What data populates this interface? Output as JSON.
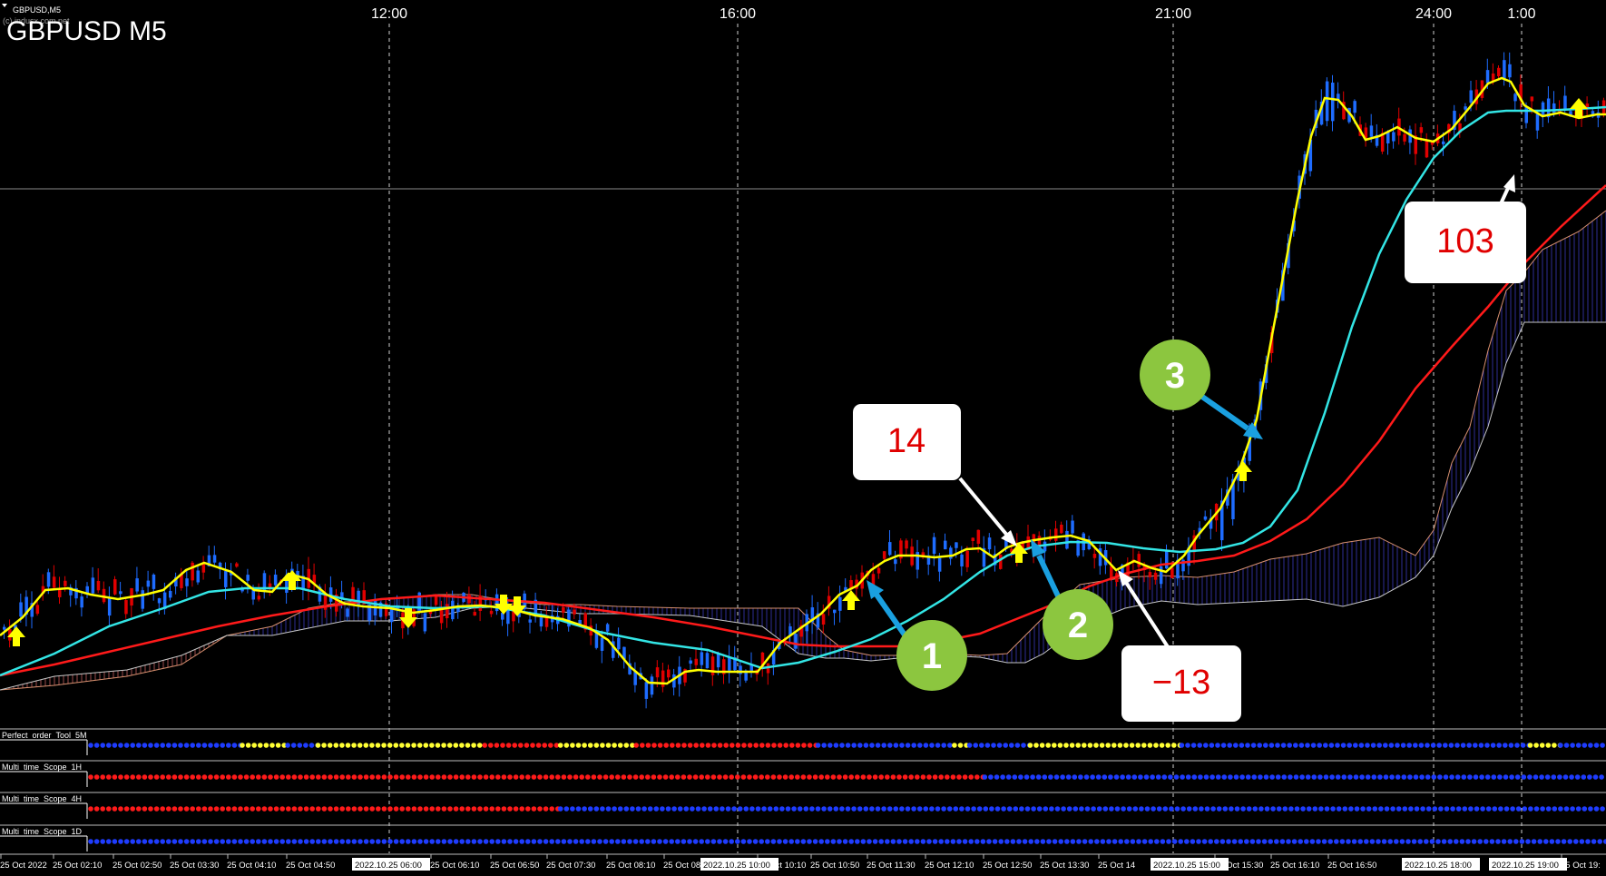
{
  "window": {
    "symbol_tab": "GBPUSD,M5",
    "subtitle": "(c) indusx.com.net",
    "title": "GBPUSD M5"
  },
  "time_labels": [
    "12:00",
    "16:00",
    "21:00",
    "24:00",
    "1:00"
  ],
  "callouts": {
    "box_14": "14",
    "box_minus13": "−13",
    "box_103": "103",
    "circle_1": "1",
    "circle_2": "2",
    "circle_3": "3"
  },
  "panels": [
    {
      "name": "Perfect_order_Tool_5M",
      "segments": [
        [
          "blue",
          0,
          10
        ],
        [
          "yellow",
          10,
          13
        ],
        [
          "blue",
          13,
          15
        ],
        [
          "yellow",
          15,
          26
        ],
        [
          "red",
          26,
          31
        ],
        [
          "yellow",
          31,
          36
        ],
        [
          "red",
          36,
          48
        ],
        [
          "blue",
          48,
          57
        ],
        [
          "yellow",
          57,
          58
        ],
        [
          "blue",
          58,
          62
        ],
        [
          "yellow",
          62,
          72
        ],
        [
          "blue",
          72,
          95
        ],
        [
          "yellow",
          95,
          97
        ],
        [
          "blue",
          97,
          100
        ]
      ]
    },
    {
      "name": "Multi_time_Scope_1H",
      "segments": [
        [
          "red",
          0,
          59
        ],
        [
          "blue",
          59,
          100
        ]
      ]
    },
    {
      "name": "Multi_time_Scope_4H",
      "segments": [
        [
          "red",
          0,
          31
        ],
        [
          "blue",
          31,
          100
        ]
      ]
    },
    {
      "name": "Multi_time_Scope_1D",
      "segments": [
        [
          "blue",
          0,
          100
        ]
      ]
    }
  ],
  "date_axis": {
    "labels": [
      "25 Oct 2022",
      "25 Oct 02:10",
      "25 Oct 02:50",
      "25 Oct 03:30",
      "25 Oct 04:10",
      "25 Oct 04:50",
      "25 Oct 06:10",
      "25 Oct 06:50",
      "25 Oct 07:30",
      "25 Oct 08:10",
      "25 Oct 08:50",
      "25 Oct 10:10",
      "25 Oct 10:50",
      "25 Oct 11:30",
      "25 Oct 12:10",
      "25 Oct 12:50",
      "25 Oct 13:30",
      "25 Oct 14",
      "25 Oct 15:30",
      "25 Oct 16:10",
      "25 Oct 16:50",
      "25 Oct 19:"
    ],
    "highlight": [
      "2022.10.25 06:00",
      "2022.10.25 10:00",
      "2022.10.25 15:00",
      "2022.10.25 18:00",
      "2022.10.25 19:00"
    ]
  },
  "colors": {
    "background": "#000000",
    "candle_up": "#1e6cff",
    "candle_down": "#e00000",
    "fast_ma": "#ffff00",
    "mid_ma": "#33e5e5",
    "slow_ma": "#ff1a1a",
    "arrow_signal": "#ffff00",
    "callout_arrow_blue": "#1aa0e0",
    "circle_green": "#8cc63f"
  }
}
